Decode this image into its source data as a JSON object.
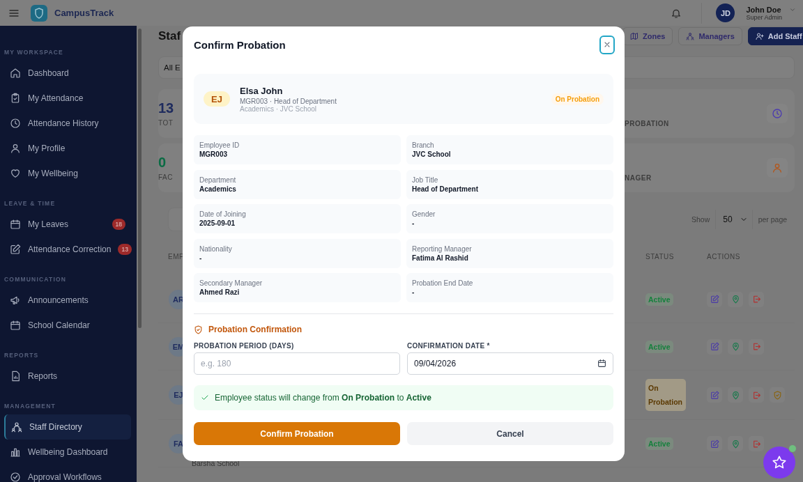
{
  "header": {
    "app_name": "CampusTrack",
    "user": {
      "initials": "JD",
      "name": "John Doe",
      "role": "Super Admin"
    }
  },
  "sidebar": {
    "sections": [
      {
        "title": "MY WORKSPACE",
        "items": [
          {
            "label": "Dashboard",
            "selected": false
          },
          {
            "label": "My Attendance",
            "selected": false
          },
          {
            "label": "Attendance History",
            "selected": false
          },
          {
            "label": "My Profile",
            "selected": false
          },
          {
            "label": "My Wellbeing",
            "selected": false
          }
        ]
      },
      {
        "title": "LEAVE & TIME",
        "items": [
          {
            "label": "My Leaves",
            "selected": false,
            "badge": "18"
          },
          {
            "label": "Attendance Correction",
            "selected": false,
            "badge": "13"
          }
        ]
      },
      {
        "title": "COMMUNICATION",
        "items": [
          {
            "label": "Announcements",
            "selected": false
          },
          {
            "label": "School Calendar",
            "selected": false
          }
        ]
      },
      {
        "title": "REPORTS",
        "items": [
          {
            "label": "Reports",
            "selected": false
          }
        ]
      },
      {
        "title": "MANAGEMENT",
        "items": [
          {
            "label": "Staff Directory",
            "selected": true
          },
          {
            "label": "Wellbeing Dashboard",
            "selected": false
          },
          {
            "label": "Approval Workflows",
            "selected": false
          }
        ]
      }
    ]
  },
  "page": {
    "title": "Staf",
    "tab": "All E",
    "buttons": [
      {
        "label": "Zones",
        "kind": "outline"
      },
      {
        "label": "Managers",
        "kind": "outline"
      },
      {
        "label": "Add Staff",
        "kind": "primary"
      }
    ],
    "stats": [
      {
        "value": "13",
        "label": "TOT",
        "right_label": "PROBATION",
        "color": "#1e2b5e"
      },
      {
        "value": "0",
        "label": "FAC",
        "right_label": "NAGER",
        "color": "#0b6b44"
      }
    ],
    "show_label": "Show",
    "page_size": "50",
    "per_page": "per page",
    "columns": [
      "EMP",
      "STATUS",
      "ACTIONS"
    ],
    "rows": [
      {
        "initials": "AR",
        "status": "Active",
        "kind": "active"
      },
      {
        "initials": "EM",
        "status": "Active",
        "kind": "active"
      },
      {
        "initials": "EJ",
        "status": "On Probation",
        "kind": "probation"
      },
      {
        "initials": "FA",
        "status": "Active",
        "kind": "active",
        "detail": "Barsha School"
      }
    ]
  },
  "modal": {
    "title": "Confirm Probation",
    "employee": {
      "initials": "EJ",
      "name": "Elsa John",
      "line1": "MGR003 · Head of Department",
      "line2": "Academics · JVC School",
      "status": "On Probation"
    },
    "fields": [
      {
        "label": "Employee ID",
        "value": "MGR003"
      },
      {
        "label": "Branch",
        "value": "JVC School"
      },
      {
        "label": "Department",
        "value": "Academics"
      },
      {
        "label": "Job Title",
        "value": "Head of Department"
      },
      {
        "label": "Date of Joining",
        "value": "2025-09-01"
      },
      {
        "label": "Gender",
        "value": "-"
      },
      {
        "label": "Nationality",
        "value": "-"
      },
      {
        "label": "Reporting Manager",
        "value": "Fatima Al Rashid"
      },
      {
        "label": "Secondary Manager",
        "value": "Ahmed Razi"
      },
      {
        "label": "Probation End Date",
        "value": "-"
      }
    ],
    "section_title": "Probation Confirmation",
    "inputs": [
      {
        "label": "PROBATION PERIOD (DAYS)",
        "placeholder": "e.g. 180",
        "kind": "number"
      },
      {
        "label": "CONFIRMATION DATE *",
        "value": "09/04/2026",
        "kind": "date"
      }
    ],
    "notice": "Employee status will change from **On Probation** to **Active**",
    "buttons": [
      {
        "label": "Confirm Probation",
        "kind": "primary"
      },
      {
        "label": "Cancel",
        "kind": "secondary"
      }
    ]
  }
}
